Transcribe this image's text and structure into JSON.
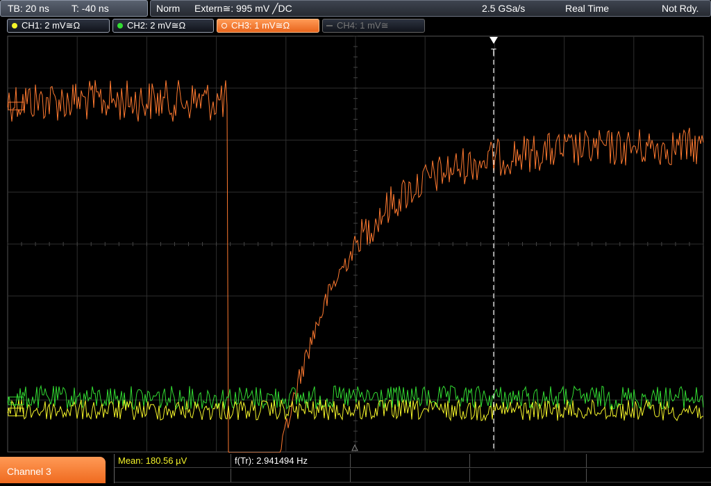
{
  "status": {
    "timebase": "TB: 20 ns",
    "trigger_time": "T: -40 ns",
    "trigger_mode": "Norm",
    "trigger_source": "Extern≅: 995 mV ╱DC",
    "sample_rate": "2.5 GSa/s",
    "acq_mode": "Real Time",
    "trigger_state": "Not Rdy."
  },
  "channels": [
    {
      "label": "CH1: 2 mV≅Ω",
      "color": "#f5f52a",
      "state": "on"
    },
    {
      "label": "CH2: 2 mV≅Ω",
      "color": "#33dd33",
      "state": "on"
    },
    {
      "label": "CH3: 1 mV≅Ω",
      "color": "#ff7a30",
      "state": "active"
    },
    {
      "label": "CH4: 1 mV≅",
      "color": "#777777",
      "state": "off"
    }
  ],
  "trigger_marker": "T",
  "selected_channel": "Channel 3",
  "measurements": {
    "mean": "Mean: 180.56 µV",
    "freq": "f(Tr): 2.941494 Hz"
  },
  "colors": {
    "ch1": "#f5f52a",
    "ch2": "#33dd33",
    "ch3": "#ff7a30",
    "grid": "#3a3a3a",
    "trigger_line": "#ffffff"
  }
}
